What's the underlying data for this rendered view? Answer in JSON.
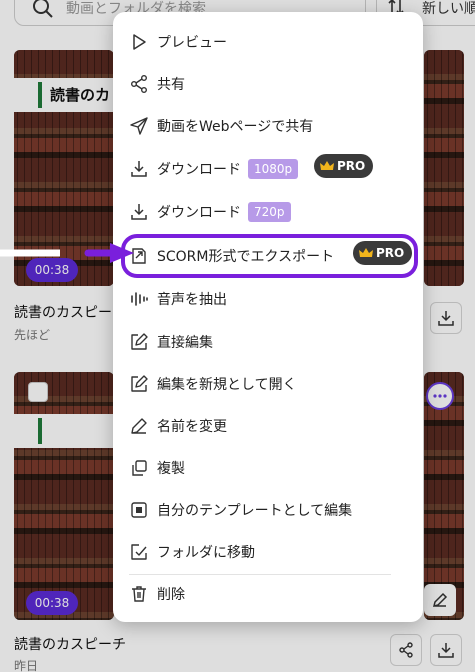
{
  "toolbar": {
    "search_placeholder": "動画とフォルダを検索",
    "sort_label": "新しい順"
  },
  "cards": [
    {
      "thumb_title": "読書のカ",
      "duration": "00:38",
      "title": "読書のカスピーチ",
      "time": "先ほど"
    },
    {
      "thumb_title": "",
      "duration": "00:38",
      "title": "読書のカスピーチ",
      "time": "昨日"
    }
  ],
  "menu": {
    "items": [
      {
        "label": "プレビュー",
        "icon": "play-icon"
      },
      {
        "label": "共有",
        "icon": "share-icon"
      },
      {
        "label": "動画をWebページで共有",
        "icon": "send-icon"
      },
      {
        "label": "ダウンロード",
        "icon": "download-icon",
        "badge": "1080p",
        "pro": "PRO"
      },
      {
        "label": "ダウンロード",
        "icon": "download-icon",
        "badge": "720p"
      },
      {
        "label": "SCORM形式でエクスポート",
        "icon": "export-icon",
        "pro": "PRO"
      },
      {
        "label": "音声を抽出",
        "icon": "audio-wave-icon"
      },
      {
        "label": "直接編集",
        "icon": "edit-icon"
      },
      {
        "label": "編集を新規として開く",
        "icon": "edit-copy-icon"
      },
      {
        "label": "名前を変更",
        "icon": "pencil-icon"
      },
      {
        "label": "複製",
        "icon": "duplicate-icon"
      },
      {
        "label": "自分のテンプレートとして編集",
        "icon": "template-icon"
      },
      {
        "label": "フォルダに移動",
        "icon": "move-folder-icon"
      },
      {
        "label": "削除",
        "icon": "trash-icon"
      }
    ]
  },
  "colors": {
    "accent": "#5b2bd6",
    "highlight": "#7a1fdc",
    "pro_badge": "#3a3a3a",
    "resolution_badge": "#b79ae8"
  }
}
